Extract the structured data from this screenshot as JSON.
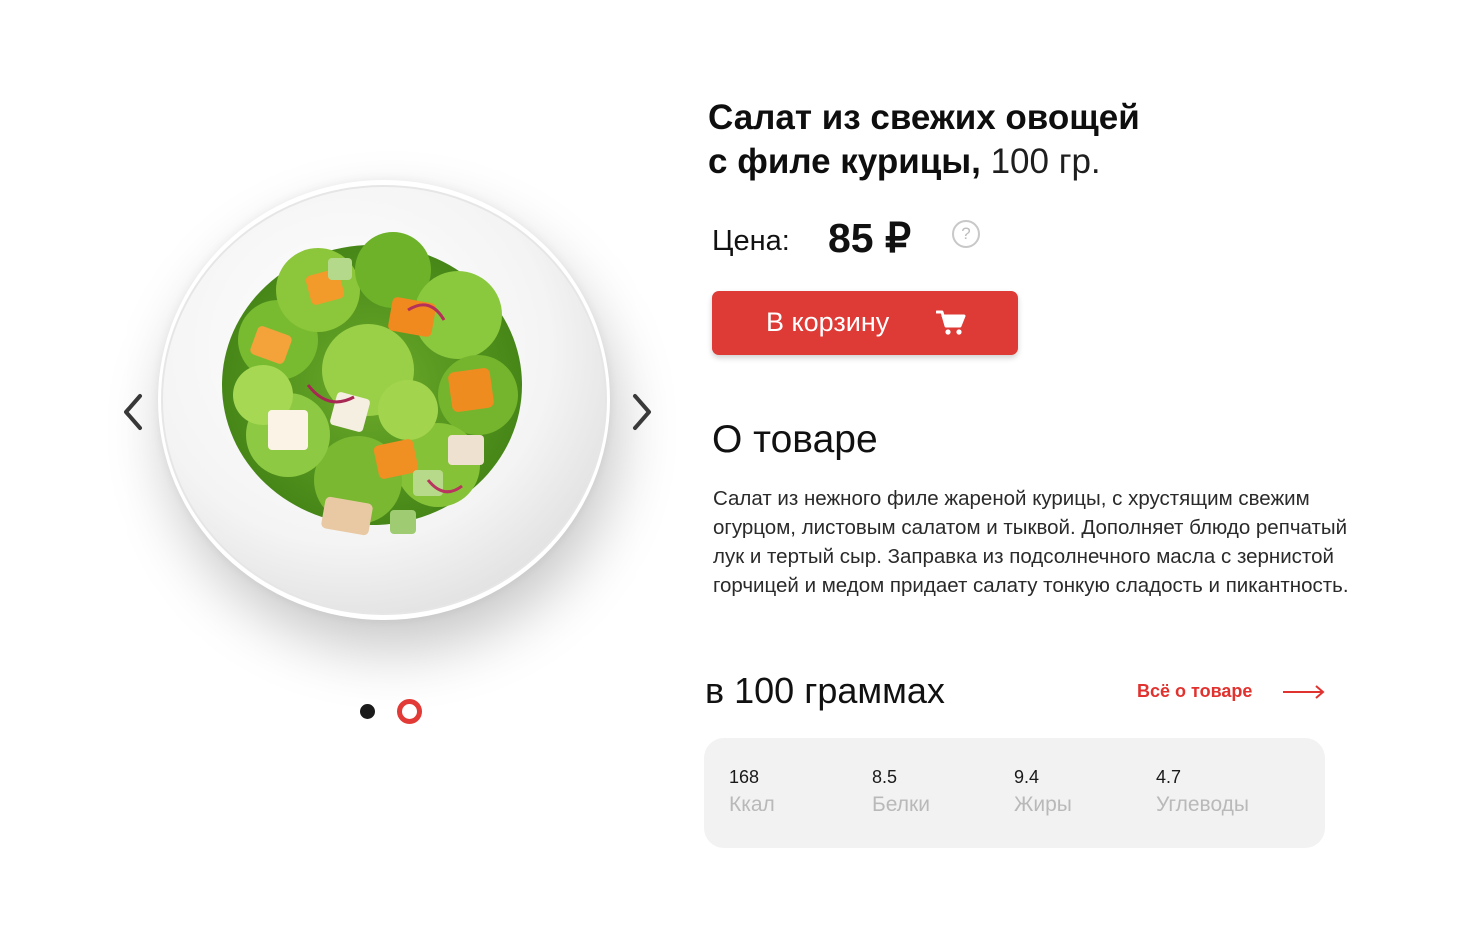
{
  "product": {
    "title_bold_line1": "Салат из свежих овощей",
    "title_bold_line2": "с филе курицы,",
    "weight": "100 гр."
  },
  "price": {
    "label": "Цена:",
    "value": "85 ₽",
    "help_glyph": "?"
  },
  "cart_button": {
    "label": "В корзину",
    "icon": "cart-icon"
  },
  "gallery": {
    "prev_icon": "chevron-left-icon",
    "next_icon": "chevron-right-icon",
    "slides": 2,
    "active_slide": 2
  },
  "about": {
    "heading": "О товаре",
    "text": "Салат из нежного филе жареной курицы, с хрустящим свежим огурцом, листовым салатом и тыквой. Дополняет блюдо репчатый лук и тертый сыр. Заправка из подсолнечного масла с зернистой горчицей и медом придает салату тонкую сладость и пикантность."
  },
  "nutrition": {
    "heading": "в 100 граммах",
    "link_label": "Всё о товаре",
    "items": [
      {
        "value": "168",
        "label": "Ккал"
      },
      {
        "value": "8.5",
        "label": "Белки"
      },
      {
        "value": "9.4",
        "label": "Жиры"
      },
      {
        "value": "4.7",
        "label": "Углеводы"
      }
    ]
  },
  "colors": {
    "accent": "#de3a36",
    "card_bg": "#f2f2f2",
    "muted_text": "#b9b9b9"
  }
}
